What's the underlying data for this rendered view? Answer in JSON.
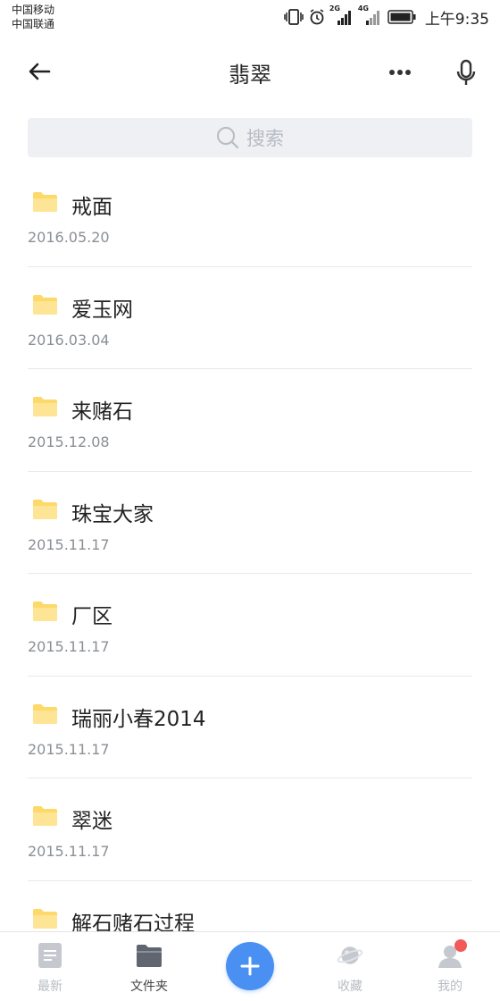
{
  "status_bar": {
    "carrier_1": "中国移动",
    "carrier_2": "中国联通",
    "net_1": "2G",
    "net_2": "4G",
    "time": "上午9:35"
  },
  "nav": {
    "title": "翡翠"
  },
  "search": {
    "placeholder": "搜索"
  },
  "files": [
    {
      "name": "戒面",
      "date": "2016.05.20"
    },
    {
      "name": "爱玉网",
      "date": "2016.03.04"
    },
    {
      "name": "来赌石",
      "date": "2015.12.08"
    },
    {
      "name": "珠宝大家",
      "date": "2015.11.17"
    },
    {
      "name": "厂区",
      "date": "2015.11.17"
    },
    {
      "name": "瑞丽小春2014",
      "date": "2015.11.17"
    },
    {
      "name": "翠迷",
      "date": "2015.11.17"
    },
    {
      "name": "解石赌石过程",
      "date": ""
    }
  ],
  "tabs": {
    "recent": "最新",
    "folders": "文件夹",
    "favorites": "收藏",
    "mine": "我的"
  },
  "colors": {
    "accent": "#4a90f2",
    "folder": "#fdd96a",
    "badge": "#f25a5a"
  }
}
